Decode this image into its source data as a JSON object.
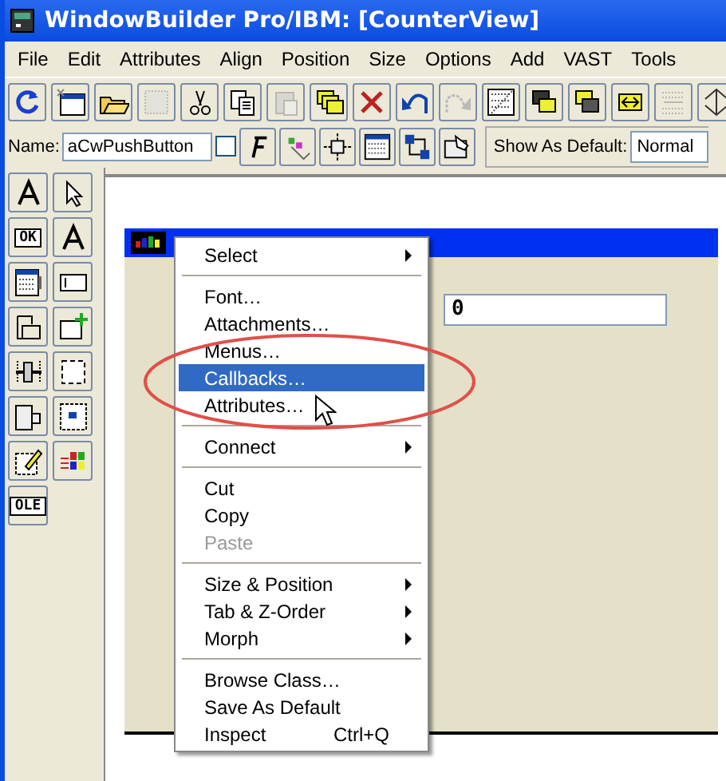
{
  "window": {
    "title": "WindowBuilder Pro/IBM: [CounterView]"
  },
  "menu_bar": [
    "File",
    "Edit",
    "Attributes",
    "Align",
    "Position",
    "Size",
    "Options",
    "Add",
    "VAST",
    "Tools"
  ],
  "toolbar": [
    {
      "kind": "refresh",
      "disabled": false
    },
    {
      "kind": "new-window",
      "disabled": false
    },
    {
      "kind": "open",
      "disabled": false
    },
    {
      "kind": "save",
      "disabled": true
    },
    {
      "kind": "cut",
      "disabled": false
    },
    {
      "kind": "copy",
      "disabled": false
    },
    {
      "kind": "paste",
      "disabled": true
    },
    {
      "kind": "duplicate",
      "disabled": false
    },
    {
      "kind": "delete",
      "disabled": false
    },
    {
      "kind": "undo",
      "disabled": false
    },
    {
      "kind": "redo",
      "disabled": true
    },
    {
      "kind": "grid",
      "disabled": false
    },
    {
      "kind": "front",
      "disabled": false
    },
    {
      "kind": "back",
      "disabled": false
    },
    {
      "kind": "hspace",
      "disabled": false
    },
    {
      "kind": "vspace",
      "disabled": true
    },
    {
      "kind": "vsize",
      "disabled": false
    }
  ],
  "name_row": {
    "label": "Name:",
    "value": "aCwPushButton",
    "checked": false,
    "tools": [
      {
        "kind": "font"
      },
      {
        "kind": "colors"
      },
      {
        "kind": "attach"
      },
      {
        "kind": "menu"
      },
      {
        "kind": "tab"
      },
      {
        "kind": "callback"
      }
    ],
    "default_label": "Show As Default:",
    "default_value": "Normal"
  },
  "palette": [
    {
      "kind": "label"
    },
    {
      "kind": "pointer"
    },
    {
      "kind": "button",
      "text": "OK"
    },
    {
      "kind": "label"
    },
    {
      "kind": "list"
    },
    {
      "kind": "entry"
    },
    {
      "kind": "group"
    },
    {
      "kind": "add"
    },
    {
      "kind": "slider"
    },
    {
      "kind": "frame"
    },
    {
      "kind": "notebook"
    },
    {
      "kind": "container"
    },
    {
      "kind": "edit"
    },
    {
      "kind": "windows"
    },
    {
      "kind": "ole",
      "text": "OLE"
    }
  ],
  "form": {
    "field_value": "0"
  },
  "context_menu": [
    {
      "kind": "item",
      "label": "Select",
      "submenu": true,
      "selected": false,
      "disabled": false
    },
    {
      "kind": "separator"
    },
    {
      "kind": "item",
      "label": "Font…",
      "submenu": false,
      "selected": false,
      "disabled": false
    },
    {
      "kind": "item",
      "label": "Attachments…",
      "submenu": false,
      "selected": false,
      "disabled": false
    },
    {
      "kind": "item",
      "label": "Menus…",
      "submenu": false,
      "selected": false,
      "disabled": false
    },
    {
      "kind": "item",
      "label": "Callbacks…",
      "submenu": false,
      "selected": true,
      "disabled": false
    },
    {
      "kind": "item",
      "label": "Attributes…",
      "submenu": false,
      "selected": false,
      "disabled": false
    },
    {
      "kind": "separator"
    },
    {
      "kind": "item",
      "label": "Connect",
      "submenu": true,
      "selected": false,
      "disabled": false
    },
    {
      "kind": "separator"
    },
    {
      "kind": "item",
      "label": "Cut",
      "submenu": false,
      "selected": false,
      "disabled": false
    },
    {
      "kind": "item",
      "label": "Copy",
      "submenu": false,
      "selected": false,
      "disabled": false
    },
    {
      "kind": "item",
      "label": "Paste",
      "submenu": false,
      "selected": false,
      "disabled": true
    },
    {
      "kind": "separator"
    },
    {
      "kind": "item",
      "label": "Size & Position",
      "submenu": true,
      "selected": false,
      "disabled": false
    },
    {
      "kind": "item",
      "label": "Tab & Z-Order",
      "submenu": true,
      "selected": false,
      "disabled": false
    },
    {
      "kind": "item",
      "label": "Morph",
      "submenu": true,
      "selected": false,
      "disabled": false
    },
    {
      "kind": "separator"
    },
    {
      "kind": "item",
      "label": "Browse Class…",
      "submenu": false,
      "selected": false,
      "disabled": false
    },
    {
      "kind": "item",
      "label": "Save As Default",
      "submenu": false,
      "selected": false,
      "disabled": false
    },
    {
      "kind": "item",
      "label": "Inspect",
      "shortcut": "Ctrl+Q",
      "submenu": false,
      "selected": false,
      "disabled": false
    }
  ]
}
